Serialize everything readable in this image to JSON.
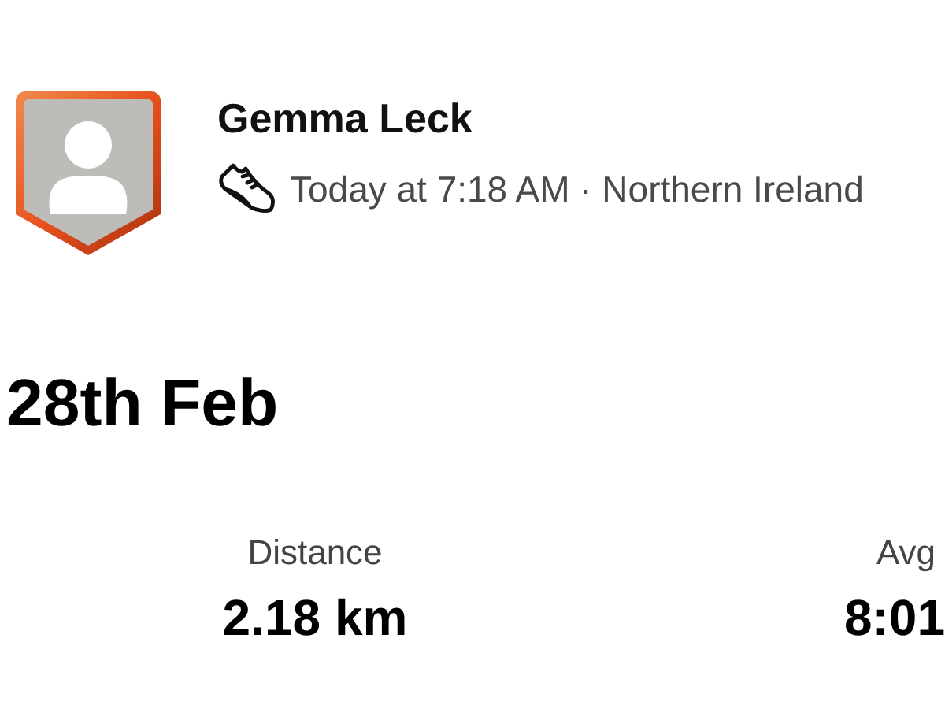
{
  "athlete": {
    "name": "Gemma Leck",
    "meta": "Today at 7:18 AM · Northern Ireland"
  },
  "activity": {
    "title": "28th Feb"
  },
  "stats": [
    {
      "label": "Distance",
      "value": "2.18 km"
    },
    {
      "label": "Avg",
      "value": "8:01"
    }
  ]
}
